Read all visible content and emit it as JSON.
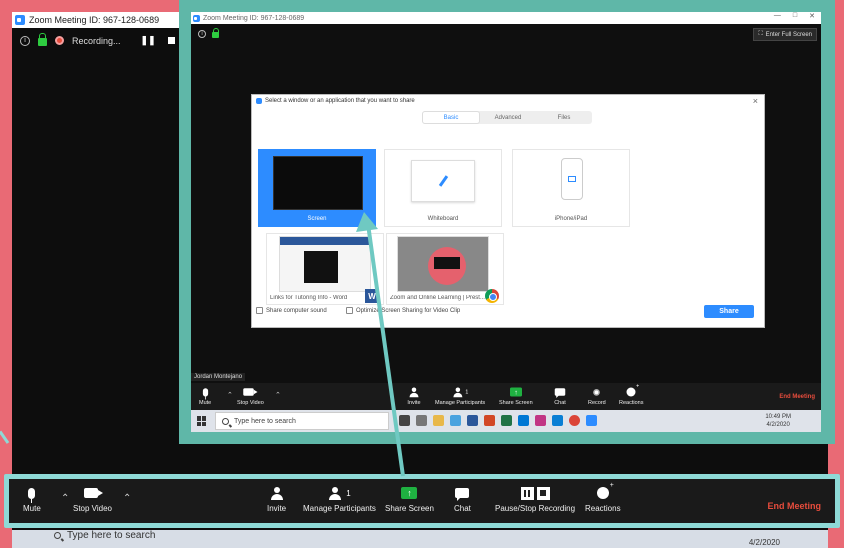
{
  "outer": {
    "title": "Zoom Meeting ID: 967-128-0689",
    "recording_label": "Recording...",
    "pause_glyph": "❚❚",
    "toolbar": {
      "mute": "Mute",
      "stop_video": "Stop Video",
      "invite": "Invite",
      "manage_participants": "Manage Participants",
      "participants_count": "1",
      "share_screen": "Share Screen",
      "chat": "Chat",
      "recording": "Pause/Stop Recording",
      "reactions": "Reactions",
      "end_meeting": "End Meeting"
    },
    "taskbar": {
      "search_placeholder": "Type here to search",
      "date": "4/2/2020"
    }
  },
  "inner": {
    "title": "Zoom Meeting ID: 967-128-0689",
    "enter_full_screen": "Enter Full Screen",
    "participant_name": "Jordan Montejano",
    "dialog": {
      "title": "Select a window or an application that you want to share",
      "tabs": [
        "Basic",
        "Advanced",
        "Files"
      ],
      "active_tab": "Basic",
      "tiles": [
        "Screen",
        "Whiteboard",
        "iPhone/iPad"
      ],
      "apps": [
        "Links for Tutoring Info - Word",
        "Zoom and Online Learning | Prest..."
      ],
      "share_sound": "Share computer sound",
      "optimize": "Optimize Screen Sharing for Video Clip",
      "share_button": "Share"
    },
    "toolbar": {
      "mute": "Mute",
      "stop_video": "Stop Video",
      "invite": "Invite",
      "manage_participants": "Manage Participants",
      "participants_count": "1",
      "share_screen": "Share Screen",
      "chat": "Chat",
      "record": "Record",
      "reactions": "Reactions",
      "end_meeting": "End Meeting"
    },
    "taskbar": {
      "search_placeholder": "Type here to search",
      "time": "10:49 PM",
      "date": "4/2/2020"
    }
  },
  "colors": {
    "background": "#e96a75",
    "highlight_frame": "#8ed9d6",
    "inner_frame": "#5fb7a8",
    "zoom_blue": "#2d8cff",
    "end_meeting_red": "#e74c3c",
    "share_green": "#1fb141"
  },
  "icons": [
    "zoom-logo-icon",
    "info-icon",
    "lock-icon",
    "record-dot-icon",
    "mic-icon",
    "camera-icon",
    "add-person-icon",
    "participants-icon",
    "share-screen-icon",
    "chat-icon",
    "pause-icon",
    "stop-icon",
    "reaction-icon",
    "pencil-icon",
    "tablet-icon",
    "word-icon",
    "chrome-icon",
    "windows-icon",
    "search-icon"
  ]
}
